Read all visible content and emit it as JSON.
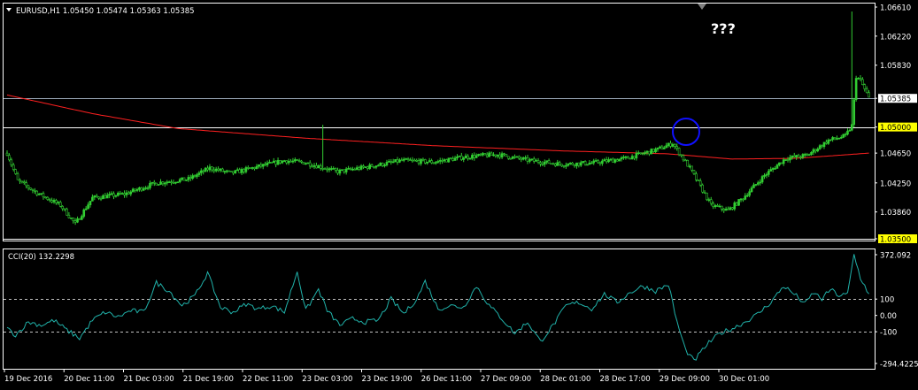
{
  "header": {
    "symbol_line": "EURUSD,H1  1.05450 1.05474 1.05363 1.05385",
    "menu_icon": "triangle-down-icon"
  },
  "annotation": {
    "question_text": "???",
    "circle_color": "#1010ff"
  },
  "colors": {
    "background": "#000000",
    "candle_up": "#32cd32",
    "candle_down": "#32cd32",
    "moving_average": "#ff2020",
    "cci_line": "#20b2aa",
    "axis_text": "#ffffff",
    "highlight_badge": "#ffff00",
    "price_badge": "#ffffff",
    "grid_dash": "#ffffff"
  },
  "chart_data": [
    {
      "type": "candlestick",
      "symbol": "EURUSD",
      "timeframe": "H1",
      "ohlc_last": {
        "open": 1.0545,
        "high": 1.05474,
        "low": 1.05363,
        "close": 1.05385
      },
      "ylim": [
        1.035,
        1.0661
      ],
      "y_ticks": [
        "1.06610",
        "1.06220",
        "1.05830",
        "1.05385",
        "1.05000",
        "1.04650",
        "1.04250",
        "1.03860",
        "1.03500"
      ],
      "x_ticks": [
        "19 Dec 2016",
        "20 Dec 11:00",
        "21 Dec 03:00",
        "21 Dec 19:00",
        "22 Dec 11:00",
        "23 Dec 03:00",
        "23 Dec 19:00",
        "26 Dec 11:00",
        "27 Dec 09:00",
        "28 Dec 01:00",
        "28 Dec 17:00",
        "29 Dec 09:00",
        "30 Dec 01:00"
      ],
      "horizontal_lines": [
        {
          "price": 1.05385,
          "label": "1.05385",
          "style": "current-price"
        },
        {
          "price": 1.05,
          "label": "1.05000",
          "style": "highlight"
        },
        {
          "price": 1.035,
          "label": "1.03500",
          "style": "highlight"
        }
      ],
      "key_prices": [
        {
          "x": 0,
          "price": 1.0465
        },
        {
          "x": 5,
          "price": 1.0428
        },
        {
          "x": 15,
          "price": 1.041
        },
        {
          "x": 25,
          "price": 1.0395
        },
        {
          "x": 32,
          "price": 1.037
        },
        {
          "x": 40,
          "price": 1.0405
        },
        {
          "x": 55,
          "price": 1.041
        },
        {
          "x": 70,
          "price": 1.0425
        },
        {
          "x": 85,
          "price": 1.043
        },
        {
          "x": 95,
          "price": 1.0445
        },
        {
          "x": 105,
          "price": 1.0438
        },
        {
          "x": 115,
          "price": 1.0445
        },
        {
          "x": 130,
          "price": 1.0455
        },
        {
          "x": 140,
          "price": 1.0452
        },
        {
          "x": 155,
          "price": 1.044
        },
        {
          "x": 170,
          "price": 1.0447
        },
        {
          "x": 185,
          "price": 1.0455
        },
        {
          "x": 200,
          "price": 1.0453
        },
        {
          "x": 215,
          "price": 1.046
        },
        {
          "x": 230,
          "price": 1.0463
        },
        {
          "x": 245,
          "price": 1.0455
        },
        {
          "x": 260,
          "price": 1.045
        },
        {
          "x": 275,
          "price": 1.0452
        },
        {
          "x": 290,
          "price": 1.0458
        },
        {
          "x": 305,
          "price": 1.047
        },
        {
          "x": 312,
          "price": 1.0478
        },
        {
          "x": 320,
          "price": 1.0445
        },
        {
          "x": 330,
          "price": 1.0395
        },
        {
          "x": 338,
          "price": 1.0388
        },
        {
          "x": 345,
          "price": 1.0405
        },
        {
          "x": 355,
          "price": 1.0435
        },
        {
          "x": 365,
          "price": 1.0458
        },
        {
          "x": 375,
          "price": 1.0462
        },
        {
          "x": 385,
          "price": 1.0482
        },
        {
          "x": 393,
          "price": 1.0488
        },
        {
          "x": 396,
          "price": 1.0502
        },
        {
          "x": 398,
          "price": 1.0568
        },
        {
          "x": 400,
          "price": 1.0562
        },
        {
          "x": 403,
          "price": 1.0545
        },
        {
          "x": 404,
          "price": 1.05385
        }
      ],
      "spikes": [
        {
          "x": 148,
          "high": 1.0503
        },
        {
          "x": 396,
          "high": 1.0655
        }
      ],
      "moving_average": [
        {
          "x": 0,
          "price": 1.0543
        },
        {
          "x": 40,
          "price": 1.0518
        },
        {
          "x": 80,
          "price": 1.0498
        },
        {
          "x": 140,
          "price": 1.0485
        },
        {
          "x": 200,
          "price": 1.0475
        },
        {
          "x": 260,
          "price": 1.0468
        },
        {
          "x": 310,
          "price": 1.0464
        },
        {
          "x": 340,
          "price": 1.0457
        },
        {
          "x": 370,
          "price": 1.0458
        },
        {
          "x": 404,
          "price": 1.0465
        }
      ],
      "x_count": 405
    },
    {
      "type": "line",
      "name": "CCI(20) 132.2298",
      "ylim": [
        -294.4225,
        372.092
      ],
      "y_ticks": [
        "372.092",
        "100",
        "0.00",
        "-100",
        "-294.4225"
      ],
      "levels": [
        100,
        -100
      ],
      "points": [
        {
          "x": 0,
          "y": -80
        },
        {
          "x": 4,
          "y": -120
        },
        {
          "x": 10,
          "y": -40
        },
        {
          "x": 16,
          "y": -60
        },
        {
          "x": 22,
          "y": -30
        },
        {
          "x": 28,
          "y": -90
        },
        {
          "x": 34,
          "y": -140
        },
        {
          "x": 40,
          "y": -30
        },
        {
          "x": 46,
          "y": 20
        },
        {
          "x": 52,
          "y": -10
        },
        {
          "x": 58,
          "y": 30
        },
        {
          "x": 64,
          "y": 20
        },
        {
          "x": 70,
          "y": 200
        },
        {
          "x": 76,
          "y": 150
        },
        {
          "x": 82,
          "y": 60
        },
        {
          "x": 88,
          "y": 120
        },
        {
          "x": 94,
          "y": 260
        },
        {
          "x": 100,
          "y": 50
        },
        {
          "x": 106,
          "y": 20
        },
        {
          "x": 112,
          "y": 70
        },
        {
          "x": 118,
          "y": 40
        },
        {
          "x": 124,
          "y": 60
        },
        {
          "x": 130,
          "y": 20
        },
        {
          "x": 136,
          "y": 270
        },
        {
          "x": 140,
          "y": 30
        },
        {
          "x": 146,
          "y": 160
        },
        {
          "x": 150,
          "y": 30
        },
        {
          "x": 156,
          "y": -60
        },
        {
          "x": 162,
          "y": -20
        },
        {
          "x": 168,
          "y": -40
        },
        {
          "x": 174,
          "y": -30
        },
        {
          "x": 180,
          "y": 100
        },
        {
          "x": 186,
          "y": 10
        },
        {
          "x": 192,
          "y": 100
        },
        {
          "x": 196,
          "y": 210
        },
        {
          "x": 202,
          "y": 40
        },
        {
          "x": 208,
          "y": 60
        },
        {
          "x": 214,
          "y": 50
        },
        {
          "x": 220,
          "y": 180
        },
        {
          "x": 226,
          "y": 60
        },
        {
          "x": 232,
          "y": -20
        },
        {
          "x": 238,
          "y": -110
        },
        {
          "x": 244,
          "y": -40
        },
        {
          "x": 250,
          "y": -160
        },
        {
          "x": 256,
          "y": -60
        },
        {
          "x": 262,
          "y": 60
        },
        {
          "x": 268,
          "y": 80
        },
        {
          "x": 274,
          "y": 40
        },
        {
          "x": 280,
          "y": 130
        },
        {
          "x": 286,
          "y": 80
        },
        {
          "x": 292,
          "y": 140
        },
        {
          "x": 298,
          "y": 180
        },
        {
          "x": 304,
          "y": 150
        },
        {
          "x": 310,
          "y": 190
        },
        {
          "x": 314,
          "y": -40
        },
        {
          "x": 318,
          "y": -210
        },
        {
          "x": 322,
          "y": -280
        },
        {
          "x": 328,
          "y": -180
        },
        {
          "x": 334,
          "y": -110
        },
        {
          "x": 340,
          "y": -80
        },
        {
          "x": 346,
          "y": -40
        },
        {
          "x": 352,
          "y": 10
        },
        {
          "x": 358,
          "y": 80
        },
        {
          "x": 364,
          "y": 180
        },
        {
          "x": 370,
          "y": 120
        },
        {
          "x": 374,
          "y": 70
        },
        {
          "x": 378,
          "y": 140
        },
        {
          "x": 382,
          "y": 100
        },
        {
          "x": 386,
          "y": 160
        },
        {
          "x": 390,
          "y": 120
        },
        {
          "x": 394,
          "y": 130
        },
        {
          "x": 397,
          "y": 372
        },
        {
          "x": 400,
          "y": 230
        },
        {
          "x": 404,
          "y": 132
        }
      ]
    }
  ]
}
